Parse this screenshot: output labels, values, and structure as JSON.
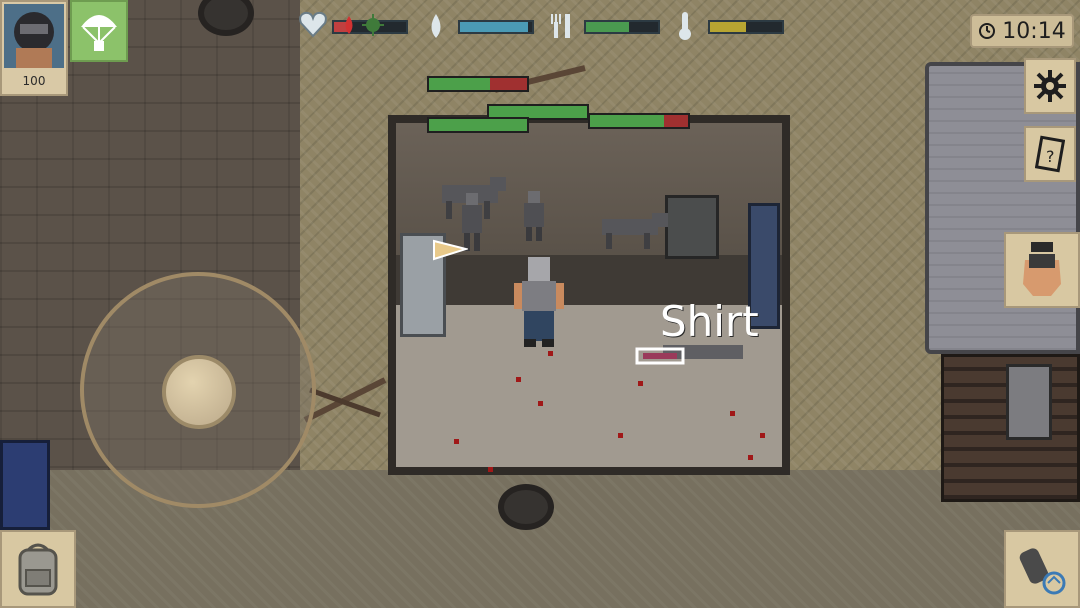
{
  "hud": {
    "clock": {
      "time": "10:14",
      "icon": "clock-icon"
    },
    "player": {
      "level": "100",
      "avatar": "helmet-avatar"
    },
    "stats": [
      {
        "name": "health",
        "icon": "heart-icon",
        "level": 0.2,
        "color": "#c04040"
      },
      {
        "name": "water",
        "icon": "water-drop-icon",
        "level": 0.95,
        "color": "#4b9bb5"
      },
      {
        "name": "food",
        "icon": "fork-knife-icon",
        "level": 0.6,
        "color": "#4a9a50"
      },
      {
        "name": "temperature",
        "icon": "thermometer-icon",
        "level": 0.5,
        "color": "#b7a532"
      }
    ]
  },
  "world": {
    "tooltip": "Shirt"
  },
  "enemy_health": [
    {
      "level": 0.62
    },
    {
      "level": 1.0
    },
    {
      "level": 1.0
    },
    {
      "level": 0.75
    }
  ],
  "buttons": {
    "parachute": "parachute-icon",
    "settings": "gear-icon",
    "journal": "journal-icon",
    "interact": "grab-hand-icon",
    "inventory": "backpack-icon",
    "swap_weapon": "weapon-swap-icon"
  }
}
